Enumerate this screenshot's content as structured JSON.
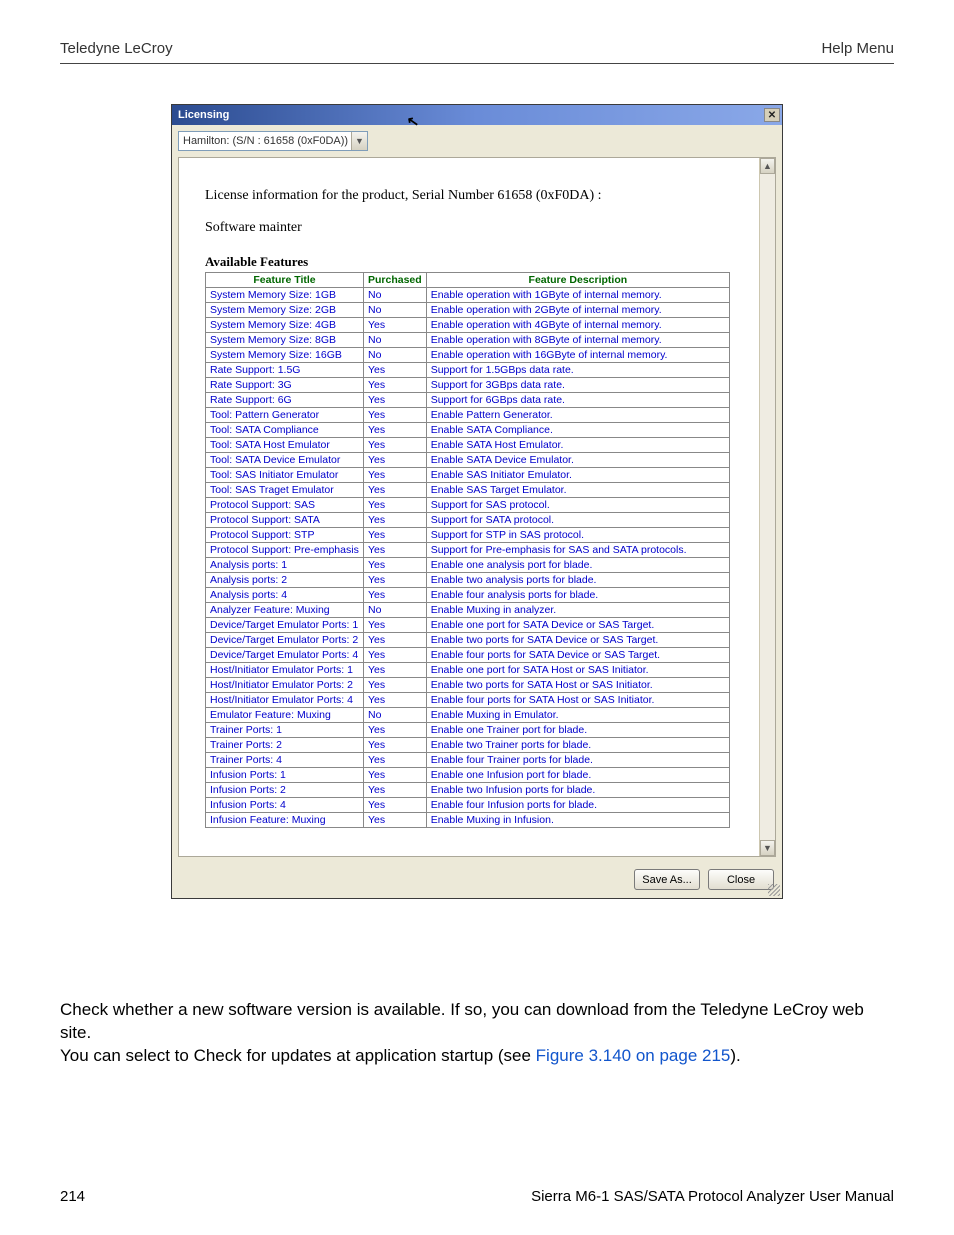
{
  "header": {
    "left": "Teledyne LeCroy",
    "right": "Help Menu"
  },
  "dialog": {
    "title": "Licensing",
    "selector": "Hamilton: (S/N : 61658 (0xF0DA))",
    "license_info": "License information for the product, Serial Number 61658 (0xF0DA) :",
    "software_mainter": "Software mainter",
    "available_label": "Available Features",
    "columns": {
      "title": "Feature Title",
      "purchased": "Purchased",
      "desc": "Feature Description"
    },
    "features": [
      {
        "t": "System Memory Size: 1GB",
        "p": "No",
        "d": "Enable operation with 1GByte of internal memory."
      },
      {
        "t": "System Memory Size: 2GB",
        "p": "No",
        "d": "Enable operation with 2GByte of internal memory."
      },
      {
        "t": "System Memory Size: 4GB",
        "p": "Yes",
        "d": "Enable operation with 4GByte of internal memory."
      },
      {
        "t": "System Memory Size: 8GB",
        "p": "No",
        "d": "Enable operation with 8GByte of internal memory."
      },
      {
        "t": "System Memory Size: 16GB",
        "p": "No",
        "d": "Enable operation with 16GByte of internal memory."
      },
      {
        "t": "Rate Support: 1.5G",
        "p": "Yes",
        "d": "Support for 1.5GBps data rate."
      },
      {
        "t": "Rate Support: 3G",
        "p": "Yes",
        "d": "Support for 3GBps data rate."
      },
      {
        "t": "Rate Support: 6G",
        "p": "Yes",
        "d": "Support for 6GBps data rate."
      },
      {
        "t": "Tool: Pattern Generator",
        "p": "Yes",
        "d": "Enable Pattern Generator."
      },
      {
        "t": "Tool: SATA Compliance",
        "p": "Yes",
        "d": "Enable SATA Compliance."
      },
      {
        "t": "Tool: SATA Host Emulator",
        "p": "Yes",
        "d": "Enable SATA Host Emulator."
      },
      {
        "t": "Tool: SATA Device Emulator",
        "p": "Yes",
        "d": "Enable SATA Device Emulator."
      },
      {
        "t": "Tool: SAS Initiator Emulator",
        "p": "Yes",
        "d": "Enable SAS Initiator Emulator."
      },
      {
        "t": "Tool: SAS Traget Emulator",
        "p": "Yes",
        "d": "Enable SAS Target Emulator."
      },
      {
        "t": "Protocol Support: SAS",
        "p": "Yes",
        "d": "Support for SAS protocol."
      },
      {
        "t": "Protocol Support: SATA",
        "p": "Yes",
        "d": "Support for SATA protocol."
      },
      {
        "t": "Protocol Support: STP",
        "p": "Yes",
        "d": "Support for STP in SAS protocol."
      },
      {
        "t": "Protocol Support: Pre-emphasis",
        "p": "Yes",
        "d": "Support for Pre-emphasis for SAS and SATA protocols."
      },
      {
        "t": "Analysis ports: 1",
        "p": "Yes",
        "d": "Enable one analysis port for blade."
      },
      {
        "t": "Analysis ports: 2",
        "p": "Yes",
        "d": "Enable two analysis ports for blade."
      },
      {
        "t": "Analysis ports: 4",
        "p": "Yes",
        "d": "Enable four analysis ports for blade."
      },
      {
        "t": "Analyzer Feature: Muxing",
        "p": "No",
        "d": "Enable Muxing in analyzer."
      },
      {
        "t": "Device/Target Emulator Ports: 1",
        "p": "Yes",
        "d": "Enable one port for SATA Device or SAS Target."
      },
      {
        "t": "Device/Target Emulator Ports: 2",
        "p": "Yes",
        "d": "Enable two ports for SATA Device or SAS Target."
      },
      {
        "t": "Device/Target Emulator Ports: 4",
        "p": "Yes",
        "d": "Enable four ports for SATA Device or SAS Target."
      },
      {
        "t": "Host/Initiator Emulator Ports: 1",
        "p": "Yes",
        "d": "Enable one port for SATA Host or SAS Initiator."
      },
      {
        "t": "Host/Initiator Emulator Ports: 2",
        "p": "Yes",
        "d": "Enable two ports for SATA Host or SAS Initiator."
      },
      {
        "t": "Host/Initiator Emulator Ports: 4",
        "p": "Yes",
        "d": "Enable four ports for SATA Host or SAS Initiator."
      },
      {
        "t": "Emulator Feature: Muxing",
        "p": "No",
        "d": "Enable Muxing in Emulator."
      },
      {
        "t": "Trainer Ports: 1",
        "p": "Yes",
        "d": "Enable one Trainer port for blade."
      },
      {
        "t": "Trainer Ports: 2",
        "p": "Yes",
        "d": "Enable two Trainer ports for blade."
      },
      {
        "t": "Trainer Ports: 4",
        "p": "Yes",
        "d": "Enable four Trainer ports for blade."
      },
      {
        "t": "Infusion Ports: 1",
        "p": "Yes",
        "d": "Enable one Infusion port for blade."
      },
      {
        "t": "Infusion Ports: 2",
        "p": "Yes",
        "d": "Enable two Infusion ports for blade."
      },
      {
        "t": "Infusion Ports: 4",
        "p": "Yes",
        "d": "Enable four Infusion ports for blade."
      },
      {
        "t": "Infusion Feature: Muxing",
        "p": "Yes",
        "d": "Enable Muxing in Infusion."
      }
    ],
    "save_as": "Save As...",
    "close": "Close"
  },
  "body": {
    "p1": "Check whether a new software version is available. If so, you can download from the Teledyne LeCroy web site.",
    "p2a": "You can select to Check for updates at application startup (see ",
    "p2link": "Figure 3.140 on page 215",
    "p2b": ")."
  },
  "footer": {
    "page": "214",
    "manual": "Sierra M6-1 SAS/SATA Protocol Analyzer User Manual"
  }
}
